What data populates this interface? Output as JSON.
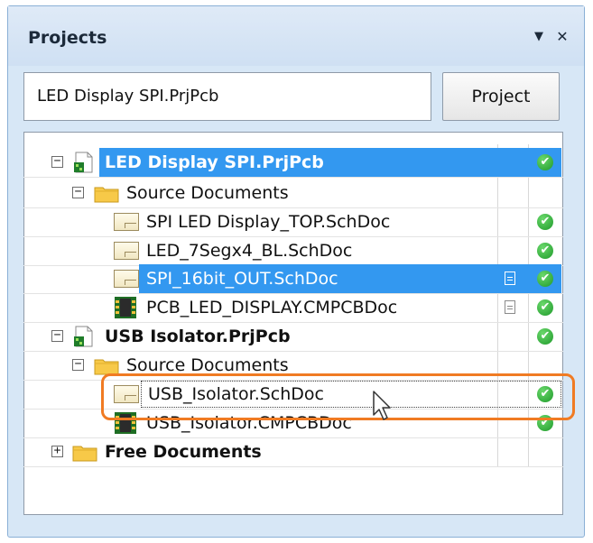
{
  "panel": {
    "title": "Projects",
    "menu_icon": "dropdown-triangle",
    "close_icon": "close-x"
  },
  "toolbar": {
    "project_field_value": "LED Display SPI.PrjPcb",
    "project_button_label": "Project"
  },
  "tree": {
    "rows": [
      {
        "label": "LED Display SPI.PrjPcb",
        "level": 0,
        "type": "project",
        "expander": "−",
        "selected": true,
        "status": "ok"
      },
      {
        "label": "Source Documents",
        "level": 1,
        "type": "folder",
        "expander": "−"
      },
      {
        "label": "SPI LED Display_TOP.SchDoc",
        "level": 2,
        "type": "schdoc",
        "status": "ok"
      },
      {
        "label": "LED_7Segx4_BL.SchDoc",
        "level": 2,
        "type": "schdoc",
        "status": "ok"
      },
      {
        "label": "SPI_16bit_OUT.SchDoc",
        "level": 2,
        "type": "schdoc",
        "selected": true,
        "modified": true,
        "status": "ok"
      },
      {
        "label": "PCB_LED_DISPLAY.CMPCBDoc",
        "level": 2,
        "type": "pcbdoc",
        "modified": true,
        "status": "ok"
      },
      {
        "label": "USB Isolator.PrjPcb",
        "level": 0,
        "type": "project",
        "expander": "−",
        "status": "ok"
      },
      {
        "label": "Source Documents",
        "level": 1,
        "type": "folder",
        "expander": "−"
      },
      {
        "label": "USB_Isolator.SchDoc",
        "level": 2,
        "type": "schdoc",
        "focused": true,
        "status": "ok"
      },
      {
        "label": "USB_Isolator.CMPCBDoc",
        "level": 2,
        "type": "pcbdoc",
        "status": "ok"
      },
      {
        "label": "Free Documents",
        "level": 0,
        "type": "folder",
        "expander": "+"
      }
    ]
  },
  "colors": {
    "selection": "#3398f0",
    "highlight_outline": "#f07b23",
    "status_ok": "#2aa838",
    "panel_bg": "#d7e7f6"
  }
}
